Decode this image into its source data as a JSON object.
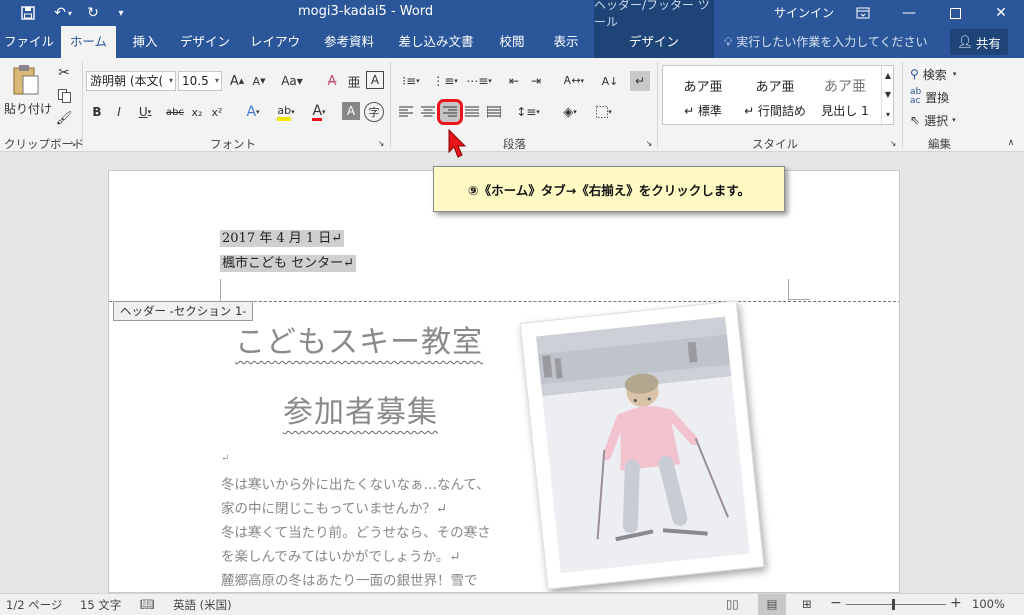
{
  "titlebar": {
    "title": "mogi3-kadai5  -  Word",
    "context_tool": "ヘッダー/フッター ツール",
    "signin": "サインイン"
  },
  "tabs": [
    {
      "label": "ファイル"
    },
    {
      "label": "ホーム"
    },
    {
      "label": "挿入"
    },
    {
      "label": "デザイン"
    },
    {
      "label": "レイアウト"
    },
    {
      "label": "参考資料"
    },
    {
      "label": "差し込み文書"
    },
    {
      "label": "校閲"
    },
    {
      "label": "表示"
    },
    {
      "label": "デザイン"
    }
  ],
  "tell_me": "実行したい作業を入力してください",
  "share": "共有",
  "ribbon": {
    "clipboard": {
      "paste": "貼り付け",
      "label": "クリップボード"
    },
    "font": {
      "name": "游明朝 (本文(",
      "size": "10.5",
      "label": "フォント"
    },
    "paragraph": {
      "label": "段落"
    },
    "styles": {
      "label": "スタイル",
      "items": [
        {
          "sample": "あア亜",
          "name": "↵ 標準"
        },
        {
          "sample": "あア亜",
          "name": "↵ 行間詰め"
        },
        {
          "sample": "あア亜",
          "name": "見出し 1"
        }
      ]
    },
    "editing": {
      "find": "検索",
      "replace": "置換",
      "select": "選択",
      "label": "編集"
    }
  },
  "callout": "⑨《ホーム》タブ→《右揃え》をクリックします。",
  "document": {
    "header_lines": [
      "2017 年 4 月 1 日↵",
      "楓市こども センター↵"
    ],
    "header_tag": "ヘッダー -セクション 1-",
    "title1": "こどもスキー教室",
    "title2": "参加者募集",
    "body": [
      "↵",
      "冬は寒いから外に出たくないなぁ…なんて、",
      "家の中に閉じこもっていませんか？↵",
      "冬は寒くて当たり前。どうせなら、その寒さ",
      "を楽しんでみてはいかがでしょうか。↵",
      "麓郷高原の冬はあたり一面の銀世界！雪で"
    ]
  },
  "status": {
    "page": "1/2 ページ",
    "words": "15 文字",
    "lang": "英語 (米国)",
    "zoom": "100%"
  }
}
